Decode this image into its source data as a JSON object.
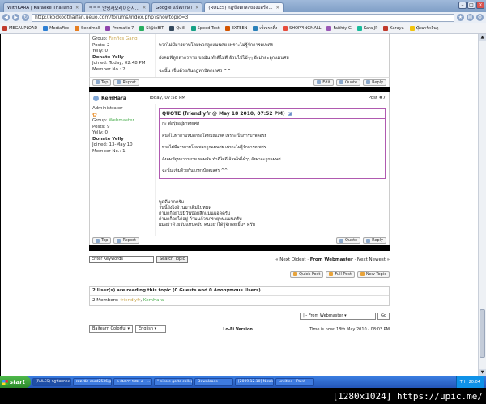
{
  "tabs": [
    {
      "label": "WithKARA | Karaoke Thailand"
    },
    {
      "label": "ㅋㅋㅋ 안녕자오레이한지..."
    },
    {
      "label": "Google แปลภาษา"
    },
    {
      "label": "(RULES) กฎข้อตกลงของบอร์ด...",
      "active": true
    }
  ],
  "address": {
    "url": "http://kookoothaifan.ueuo.com/forums/index.php?showtopic=3"
  },
  "bookmarks": [
    {
      "label": "MEGAUPLOAD",
      "color": "#c0392b"
    },
    {
      "label": "MediaFire",
      "color": "#2d7fd3"
    },
    {
      "label": "Sendmall",
      "color": "#e67e22"
    },
    {
      "label": "Promatic 7",
      "color": "#8e44ad"
    },
    {
      "label": "SI@inBIT",
      "color": "#27ae60"
    },
    {
      "label": "Quill",
      "color": "#34495e"
    },
    {
      "label": "Speed Test",
      "color": "#16a085"
    },
    {
      "label": "EXTEEN",
      "color": "#d35400"
    },
    {
      "label": "เช็คเรตติ้ง",
      "color": "#2980b9"
    },
    {
      "label": "SHOPPINGMALL",
      "color": "#e74c3c"
    },
    {
      "label": "Faithty G",
      "color": "#9b59b6"
    },
    {
      "label": "Kara JP",
      "color": "#1abc9c"
    },
    {
      "label": "Karaya",
      "color": "#c0392b"
    },
    {
      "label": "บุ๊คมาร์คอื่นๆ",
      "color": "#f1c40f"
    }
  ],
  "post1": {
    "group_label": "Group:",
    "group_value": "Fanfics Gang",
    "posts": "Posts: 2",
    "yelly": "Yelly: 0",
    "donate": "Donate Yelly",
    "joined": "Joined: Today, 02:48 PM",
    "member": "Member No.: 2",
    "lines": [
      "พวกไม่มีมารยาทโลมพวกลูกแมนศย เพราะไม่รู้จักการตเพศร",
      "อังคมฟัดูทลากรหาย ขอมัน ทำดีไม่ดี อ้วนไปไม้ๆๆ อังม่าอะลูกแมนศย",
      "ฉะนั้น เข็มด้วยกันกฎหาบัตตเลศร ^^"
    ],
    "buttons": {
      "top": "Top",
      "report": "Report",
      "edit": "Edit",
      "quote": "Quote",
      "reply": "Reply"
    }
  },
  "post2": {
    "username": "KemHara",
    "date": "Today, 07:58 PM",
    "post_no": "Post #7",
    "role": "Administrator",
    "group_label": "Group:",
    "group_value": "Webmaster",
    "posts": "Posts: 9",
    "yelly": "Yelly: 0",
    "donate": "Donate Yelly",
    "joined": "Joined: 13-May 10",
    "member": "Member No.: 1",
    "quote_header": "QUOTE (friendlyfr @ May 18 2010, 07:52 PM)",
    "quote_lines": [
      "กะ ฟอรุ่มอยู่ผาพหเศศ",
      "คนที่ไม่ทำตามหมดกรอโดหมณแพศ เพราะเป็นการบำพลอริย",
      "พวกไม่มีมารยาทโดมพวกลูกแมนศย เพราะไม่รู้จักการตเพศร",
      "อังคมฟัดูหลากรหาย ขอมมัน ทำดีไม่ดี อ้วนไปไม้ๆๆ อังม่าอะลูกแมนศ",
      "ฉะนั้น เข็มด้วยกันกฎหาบัตตเลศร ^^"
    ],
    "lines": [
      "พูดดีมากครับ",
      "วันนี้ยังไงอ้วนมาเต็มไปหมด",
      "ก้ามกก็อยไม่มีวันบ้อยลีกแมนแอดครับ",
      "ก้ามกก็อยไก่อยู่ ก้ามนก้วนกรายุพนแมนครับ",
      "ผมอย่าด้วยวันแทนครับ คนอย่าได้รู้จักเลยยิ้มๆ ครับ"
    ],
    "buttons": {
      "top": "Top",
      "report": "Report",
      "quote": "Quote",
      "reply": "Reply"
    }
  },
  "topic_nav": {
    "search_value": "Enter Keywords",
    "search_button": "Search Topic",
    "prev": "« Next Oldest",
    "sep": "·",
    "forum": "From Webmaster",
    "next": "Next Newest »"
  },
  "topic_buttons": {
    "quick": "Quick Post",
    "full": "Full Post",
    "new": "New Topic"
  },
  "readers": {
    "header": "2 User(s) are reading this topic (0 Guests and 0 Anonymous Users)",
    "members_label": "2 Members:",
    "member1": "friendlyfr",
    "member2": "KemHara"
  },
  "jump": {
    "selected": "|-- From Webmaster",
    "go": "Go"
  },
  "footer": {
    "skin": "Baifearn Colorful",
    "lang": "English",
    "lofi": "Lo-Fi Version",
    "time": "Time is now: 18th May 2010 - 08:03 PM"
  },
  "taskbar": {
    "start": "start",
    "tasks": [
      {
        "label": "(RULES) กฎข้อตกลง..."
      },
      {
        "label": "เพลงนัก cood2536@ho..."
      },
      {
        "label": "a สมการ หอพ ★~..."
      },
      {
        "label": "\" nicole go to college..."
      },
      {
        "label": "Downloads"
      },
      {
        "label": "[2009.12.10] Nicole ..."
      },
      {
        "label": "untitled - Paint"
      }
    ],
    "lang": "TH",
    "clock": "20:04"
  },
  "watermark": "[1280x1024] https://upic.me/"
}
